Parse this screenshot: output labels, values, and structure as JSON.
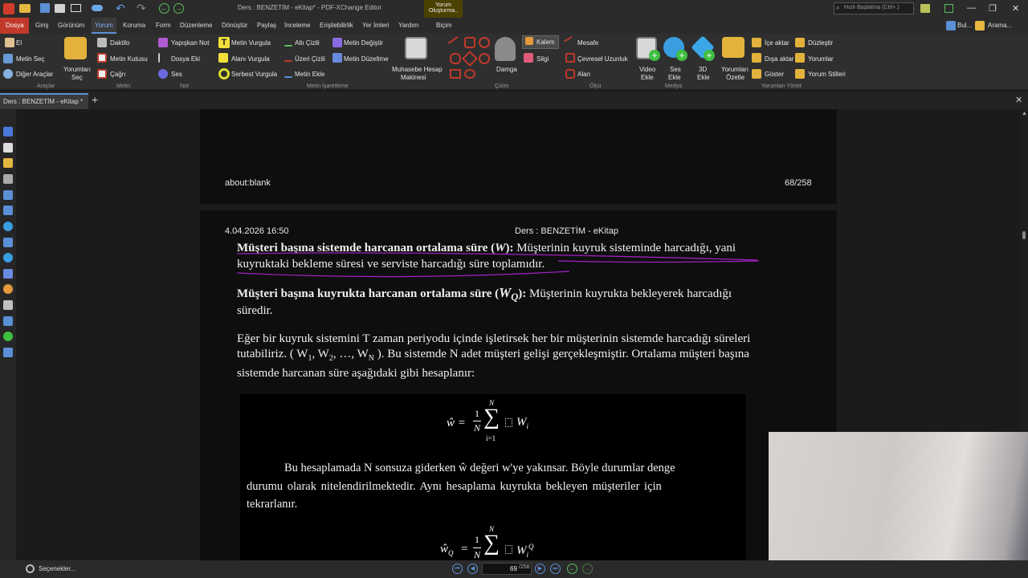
{
  "window": {
    "title": "Ders : BENZETİM - eKitap* - PDF-XChange Editor",
    "search_placeholder": "Hızlı Başlatma (Ctrl+.)",
    "context_tab_top": "Yorum",
    "context_tab_bottom": "Oluşturma..",
    "context_tab_sub": "Biçim",
    "find_label": "Bul...",
    "search_label": "Arama..."
  },
  "menu": [
    "Dosya",
    "Giriş",
    "Görünüm",
    "Yorum",
    "Koruma",
    "Form",
    "Düzenleme",
    "Dönüştür",
    "Paylaş",
    "İnceleme",
    "Erişilebilirlik",
    "Yer İmleri",
    "Yardım"
  ],
  "ribbon": {
    "tools": {
      "hand": "El",
      "select_text": "Metin Seç",
      "other_tools": "Diğer Araçlar",
      "select_comments_1": "Yorumları",
      "select_comments_2": "Seç",
      "group": "Araçlar"
    },
    "text": {
      "typewriter": "Daktilo",
      "text_box": "Metin Kutusu",
      "callout": "Çağrı",
      "group": "Metin"
    },
    "note": {
      "sticky": "Yapışkan Not",
      "file_attach": "Dosya Eki",
      "sound": "Ses",
      "group": "Not"
    },
    "highlight": {
      "text_hl": "Metin Vurgula",
      "area_hl": "Alanı Vurgula",
      "free_hl": "Serbest Vurgula",
      "underline": "Altı Çizili",
      "strikeout": "Üzeri Çizili",
      "add_text": "Metin Ekle",
      "replace_text": "Metin Değiştir",
      "edit_text": "Metin Düzeltme",
      "group": "Metin İşaretleme"
    },
    "calc_1": "Muhasebe Hesap",
    "calc_2": "Makinesi",
    "drawing": {
      "stamp": "Damga",
      "pencil": "Kalem",
      "eraser": "Silgi",
      "group": "Çizim"
    },
    "measure": {
      "distance": "Mesafe",
      "perimeter": "Çevresel Uzunluk",
      "area": "Alan",
      "group": "Ölçü"
    },
    "media": {
      "video_1": "Video",
      "video_2": "Ekle",
      "sound_1": "Ses",
      "sound_2": "Ekle",
      "three_d_1": "3D",
      "three_d_2": "Ekle",
      "group": "Medya"
    },
    "manage": {
      "summarize_1": "Yorumları",
      "summarize_2": "Özetle",
      "import": "İçe aktar",
      "export": "Dışa aktar",
      "show": "Göster",
      "flatten": "Düzleştir",
      "comments": "Yorumlar",
      "styles": "Yorum Stilleri",
      "group": "Yorumları Yönet"
    }
  },
  "doc_tab": "Ders : BENZETİM - eKitap *",
  "page_top": {
    "left": "about:blank",
    "right": "68/258"
  },
  "page_header": {
    "date": "4.04.2026 16:50",
    "title": "Ders : BENZETİM - eKitap"
  },
  "body": {
    "p1_bold": "Müşteri başına sistemde harcanan ortalama süre (",
    "p1_var": "W",
    "p1_close": "):",
    "p1_rest": " Müşterinin kuyruk sisteminde harcadığı, yani",
    "p1_line2": "kuyruktaki bekleme süresi ve serviste harcadığı süre toplamıdır.",
    "p2_bold": "Müşteri başına kuyrukta harcanan ortalama süre (",
    "p2_var": "W",
    "p2_sub": "Q",
    "p2_close": "):",
    "p2_rest": " Müşterinin kuyrukta bekleyerek harcadığı",
    "p2_line2": "süredir.",
    "p3_line1": "Eğer bir kuyruk sistemini T zaman periyodu içinde işletirsek her bir müşterinin sistemde harcadığı süreleri",
    "p3_a": "tutabiliriz. ( W",
    "p3_s1": "1",
    "p3_b": ", W",
    "p3_s2": "2",
    "p3_c": ", …, W",
    "p3_sn": "N",
    "p3_d": " ). Bu sistemde N adet müşteri gelişi gerçekleşmiştir. Ortalama müşteri başına",
    "p3_line3": "sistemde harcanan süre aşağıdaki gibi hesaplanır:"
  },
  "formula_box": {
    "eq1_lhs": "ŵ =",
    "eq1_num": "1",
    "eq1_den": "N",
    "sum_top": "N",
    "sum_sym": "∑",
    "sum_bot": "i=1",
    "eq1_term": "W",
    "eq1_term_sub": "i",
    "para_1": "Bu hesaplamada N sonsuza giderken ŵ değeri w'ye yakınsar. Böyle durumlar denge",
    "para_2": "durumu olarak nitelendirilmektedir. Aynı hesaplama kuyrukta bekleyen müşteriler için",
    "para_3": "tekrarlanır.",
    "eq2_lhs": "ŵ",
    "eq2_lhs_sub": "Q",
    "eq2_eq": "=",
    "eq2_num": "1",
    "eq2_den": "N",
    "eq2_term": "W",
    "eq2_term_sub": "i",
    "eq2_term_sup": "Q"
  },
  "status": {
    "options": "Seçenekler...",
    "page_current": "69",
    "page_total": "/258"
  },
  "colors": {
    "accent": "#c0392b",
    "ribbon_bg": "#2f2f2f",
    "highlight_tab": "#4a4200",
    "ink": "#a020c0"
  }
}
